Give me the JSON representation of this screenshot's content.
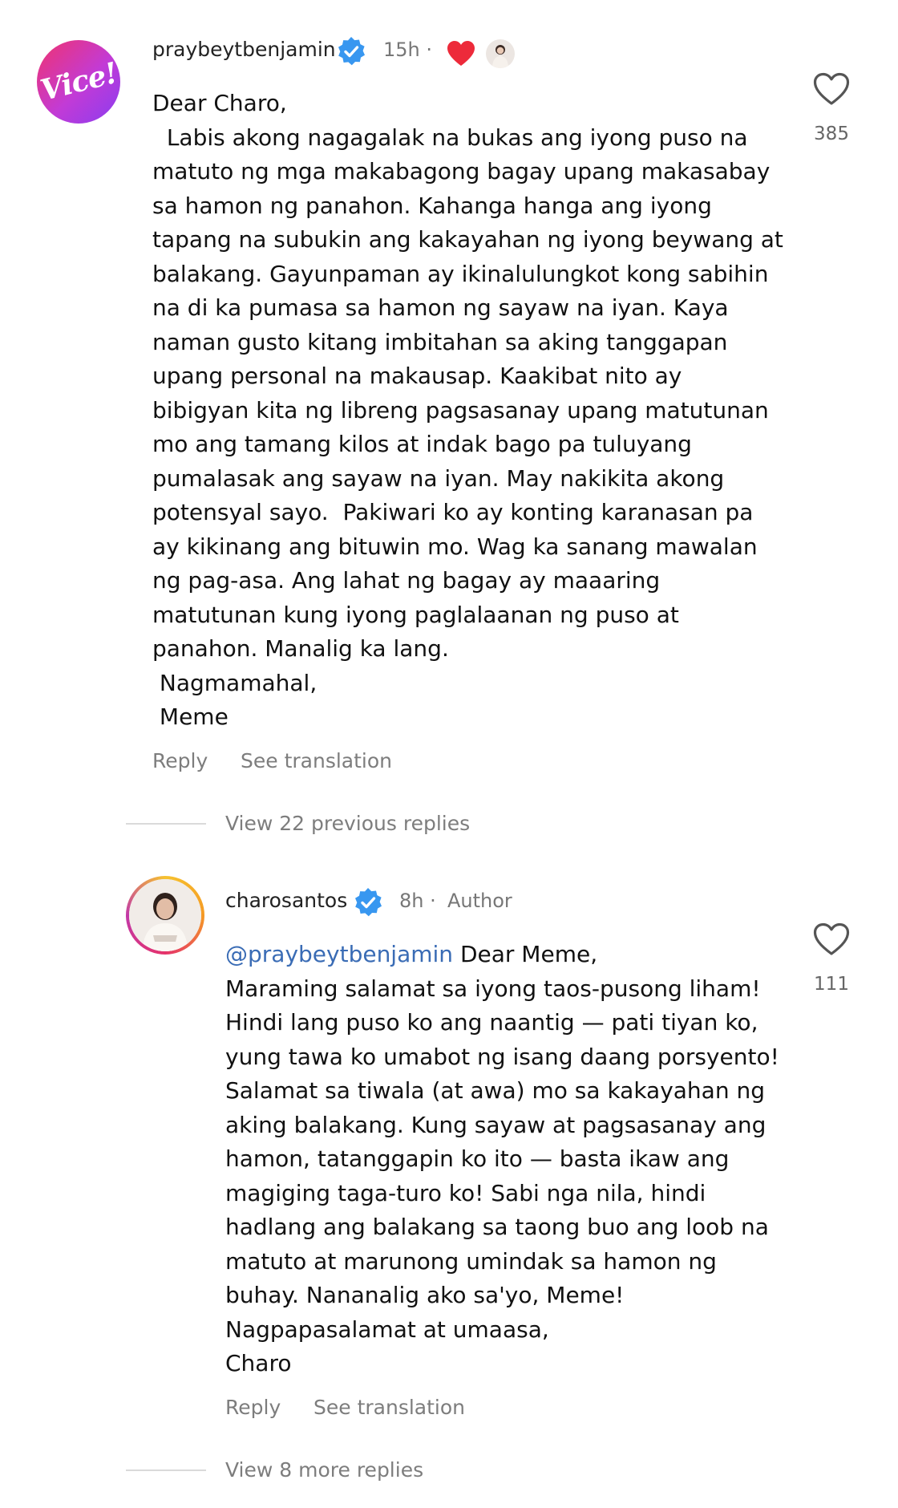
{
  "comments": [
    {
      "avatar_text": "Vice!",
      "username": "praybeytbenjamin",
      "time": "15h ·",
      "body": "Dear Charo,\n  Labis akong nagagalak na bukas ang iyong puso na\nmatuto ng mga makabagong bagay upang makasabay\nsa hamon ng panahon. Kahanga hanga ang iyong\ntapang na subukin ang kakayahan ng iyong beywang at\nbalakang. Gayunpaman ay ikinalulungkot kong sabihin\nna di ka pumasa sa hamon ng sayaw na iyan. Kaya\nnaman gusto kitang imbitahan sa aking tanggapan\nupang personal na makausap. Kaakibat nito ay\nbibigyan kita ng libreng pagsasanay upang matutunan\nmo ang tamang kilos at indak bago pa tuluyang\npumalasak ang sayaw na iyan. May nakikita akong\npotensyal sayo.  Pakiwari ko ay konting karanasan pa\nay kikinang ang bituwin mo. Wag ka sanang mawalan\nng pag-asa. Ang lahat ng bagay ay maaaring\nmatutunan kung iyong paglalaanan ng puso at\npanahon. Manalig ka lang.\n Nagmamahal,\n Meme",
      "like_count": "385",
      "reply_label": "Reply",
      "translate_label": "See translation"
    },
    {
      "username": "charosantos",
      "time": "8h ·",
      "author_badge": "Author",
      "mention": "@praybeytbenjamin",
      "body_first_line": " Dear Meme,",
      "body": "Maraming salamat sa iyong taos-pusong liham!\nHindi lang puso ko ang naantig — pati tiyan ko,\nyung tawa ko umabot ng isang daang porsyento!\nSalamat sa tiwala (at awa) mo sa kakayahan ng\naking balakang. Kung sayaw at pagsasanay ang\nhamon, tatanggapin ko ito — basta ikaw ang\nmagiging taga-turo ko! Sabi nga nila, hindi\nhadlang ang balakang sa taong buo ang loob na\nmatuto at marunong umindak sa hamon ng\nbuhay. Nananalig ako sa'yo, Meme!\nNagpapasalamat at umaasa,\nCharo",
      "like_count": "111",
      "reply_label": "Reply",
      "translate_label": "See translation"
    }
  ],
  "view_previous": "View 22 previous replies",
  "view_more": "View 8 more replies",
  "colors": {
    "verified_blue": "#3897f0",
    "heart_red": "#ed2a3a",
    "mention_blue": "#3a6cb5",
    "muted_text": "#7d7d7d"
  },
  "icons": [
    "verified-badge-icon",
    "red-heart-icon",
    "heart-outline-icon"
  ]
}
